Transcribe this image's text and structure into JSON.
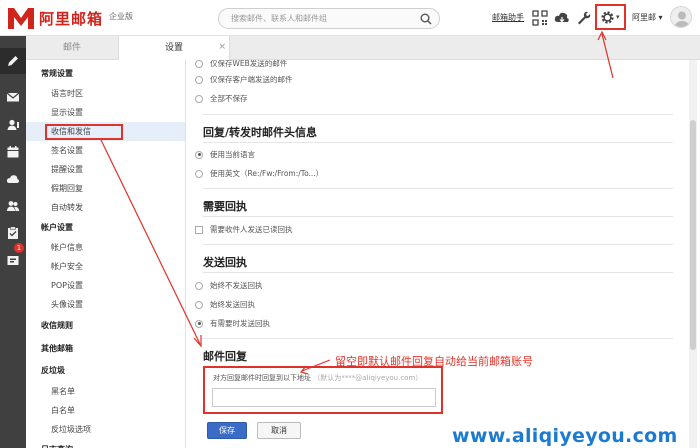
{
  "app": {
    "logo_text": "阿里邮箱",
    "edition": "企业版"
  },
  "topbar": {
    "search_placeholder": "搜索邮件、联系人和邮件组",
    "mail_assistant": "邮箱助手",
    "user_menu": "阿里邮"
  },
  "tabs": {
    "mail": "邮件",
    "settings": "设置",
    "close": "×"
  },
  "rail": {
    "badge": "1"
  },
  "nav": {
    "general": "常规设置",
    "language": "语言时区",
    "display": "显示设置",
    "send_receive": "收信和发信",
    "signature": "签名设置",
    "reminder": "提醒设置",
    "vacation": "假期回复",
    "auto_forward": "自动转发",
    "account_settings": "帐户设置",
    "account_info": "帐户信息",
    "account_security": "帐户安全",
    "pop": "POP设置",
    "avatar": "头像设置",
    "rules": "收信规则",
    "other_mailbox": "其他邮箱",
    "spam": "反垃圾",
    "blacklist": "黑名单",
    "whitelist": "白名单",
    "spam_options": "反垃圾选项",
    "more": "日志查询"
  },
  "content": {
    "top_partial": "仅保存WEB发送的邮件",
    "save_client": "仅保存客户端发送的邮件",
    "save_none": "全部不保存",
    "reply_header_title": "回复/转发时邮件头信息",
    "use_current_lang": "使用当前语言",
    "use_english": "使用英文（Re:/Fw:/From:/To...）",
    "read_receipt_title": "需要回执",
    "read_receipt_opt": "需要收件人发送已读回执",
    "send_receipt_title": "发送回执",
    "never_send": "始终不发送回执",
    "always_send": "始终发送回执",
    "ask_send": "有需要时发送回执",
    "reply_title": "邮件回复",
    "reply_label": "对方回复邮件时回复到以下地址",
    "reply_hint": "（默认为****@aliqiyeyou.com）",
    "reply_value": "",
    "save": "保存",
    "cancel": "取消"
  },
  "annotation": "留空即默认邮件回复自动给当前邮箱账号",
  "watermark": "www.aliqiyeyou.com",
  "colors": {
    "brand_red": "#d0251d",
    "highlight_red": "#e0322a",
    "primary_blue": "#3a6cc7",
    "rail": "#404040",
    "watermark_blue": "#1c7ad0"
  }
}
